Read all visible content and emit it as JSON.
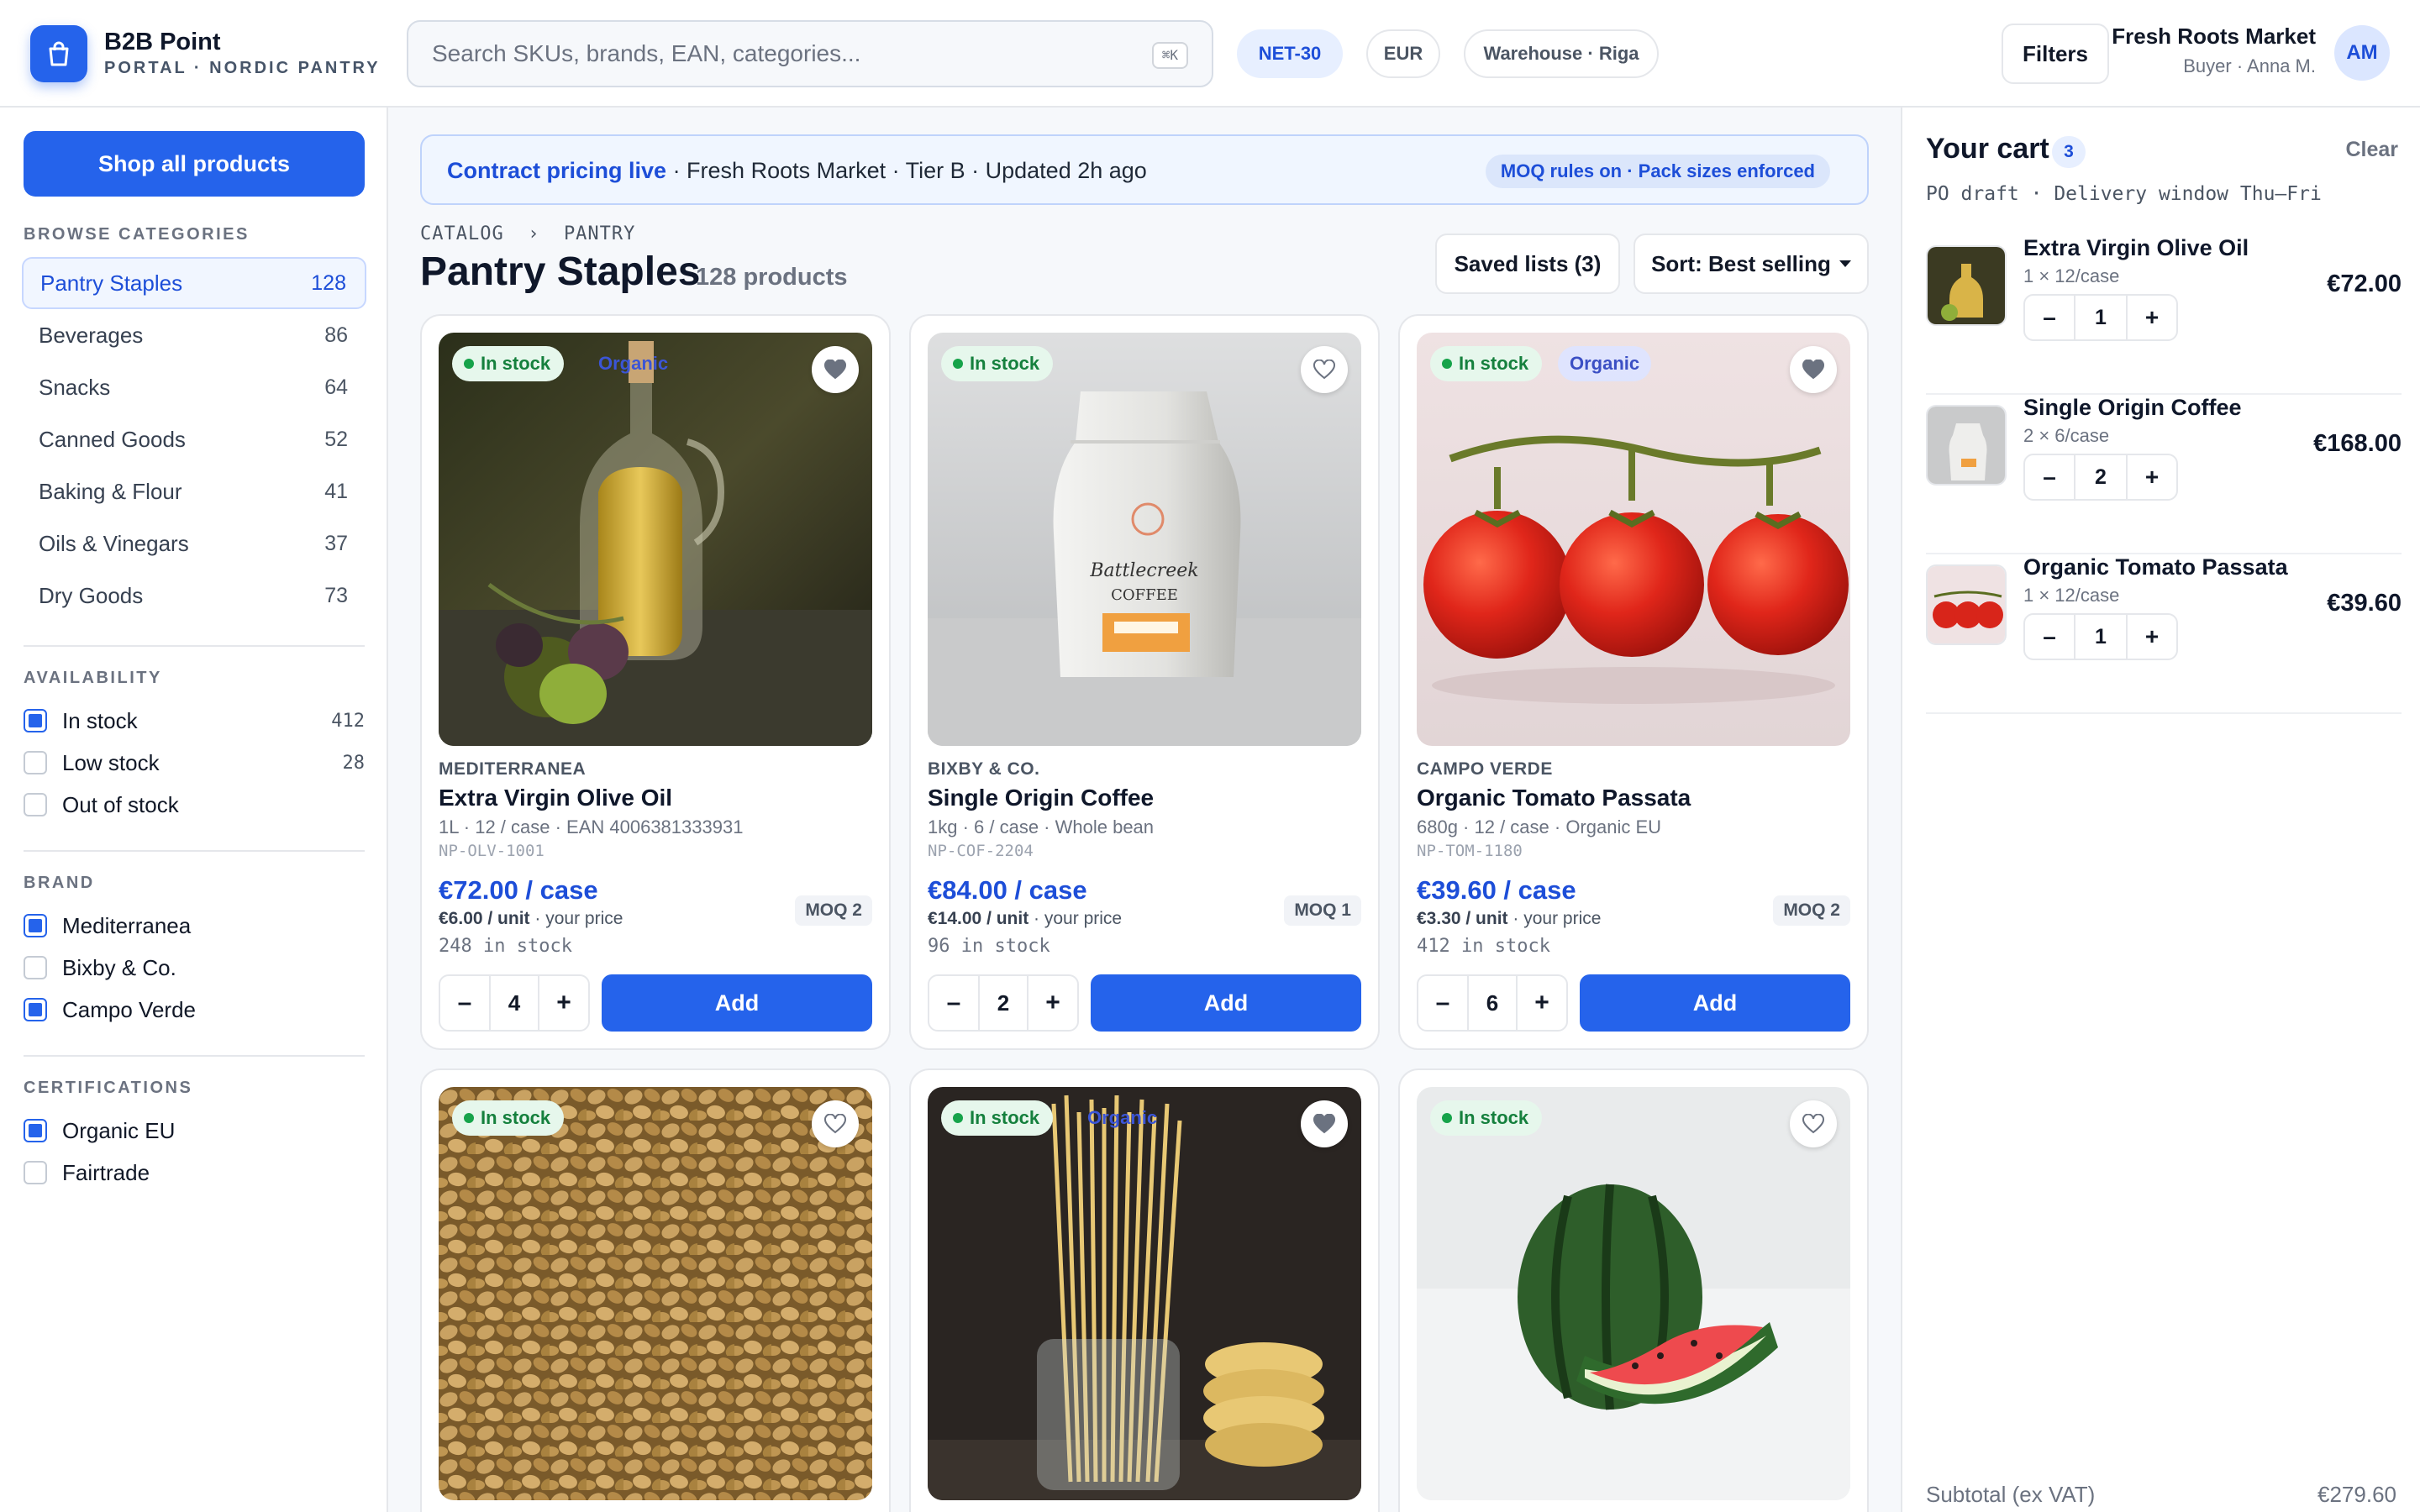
{
  "app": {
    "name": "B2B Point",
    "subtitle": "PORTAL · NORDIC PANTRY"
  },
  "search": {
    "placeholder": "Search SKUs, brands, EAN, categories...",
    "shortcut": "⌘K"
  },
  "pills": {
    "terms": "NET-30",
    "currency": "EUR",
    "warehouse": "Warehouse · Riga"
  },
  "header": {
    "filters_label": "Filters",
    "account_name": "Fresh Roots Market",
    "account_role": "Buyer · Anna M.",
    "avatar_initials": "AM"
  },
  "sidebar": {
    "shop_all_label": "Shop all products",
    "categories_title": "BROWSE CATEGORIES",
    "categories": [
      {
        "label": "Pantry Staples",
        "count": "128"
      },
      {
        "label": "Beverages",
        "count": "86"
      },
      {
        "label": "Snacks",
        "count": "64"
      },
      {
        "label": "Canned Goods",
        "count": "52"
      },
      {
        "label": "Baking & Flour",
        "count": "41"
      },
      {
        "label": "Oils & Vinegars",
        "count": "37"
      },
      {
        "label": "Dry Goods",
        "count": "73"
      }
    ],
    "availability_title": "AVAILABILITY",
    "availability": [
      {
        "label": "In stock",
        "count": "412",
        "checked": true
      },
      {
        "label": "Low stock",
        "count": "28",
        "checked": false
      },
      {
        "label": "Out of stock",
        "count": "",
        "checked": false
      }
    ],
    "brand_title": "BRAND",
    "brands": [
      {
        "label": "Mediterranea",
        "checked": true
      },
      {
        "label": "Bixby & Co.",
        "checked": false
      },
      {
        "label": "Campo Verde",
        "checked": true
      }
    ],
    "cert_title": "CERTIFICATIONS",
    "certs": [
      {
        "label": "Organic EU",
        "checked": true
      },
      {
        "label": "Fairtrade",
        "checked": false
      }
    ]
  },
  "banner": {
    "highlight": "Contract pricing live",
    "details": " · Fresh Roots Market · Tier B · Updated 2h ago",
    "rules": "MOQ rules on · Pack sizes enforced"
  },
  "main": {
    "breadcrumb": "CATALOG  ›  PANTRY",
    "title": "Pantry Staples",
    "count": "128 products",
    "saved_label": "Saved lists (3)",
    "sort_label": "Sort: Best selling"
  },
  "products": [
    {
      "stock_badge": "In stock",
      "organic_badge": "Organic",
      "brand": "MEDITERRANEA",
      "name": "Extra Virgin Olive Oil",
      "spec": "1L · 12 / case · EAN 4006381333931",
      "sku": "NP-OLV-1001",
      "price": "€72.00 / case",
      "unit_price": "€6.00 / unit",
      "unit_note": " · your price",
      "stock": "248 in stock",
      "moq": "MOQ 2",
      "qty": "4",
      "add_label": "Add"
    },
    {
      "stock_badge": "In stock",
      "organic_badge": "",
      "brand": "BIXBY & CO.",
      "name": "Single Origin Coffee",
      "spec": "1kg · 6 / case · Whole bean",
      "sku": "NP-COF-2204",
      "price": "€84.00 / case",
      "unit_price": "€14.00 / unit",
      "unit_note": " · your price",
      "stock": "96 in stock",
      "moq": "MOQ 1",
      "qty": "2",
      "add_label": "Add"
    },
    {
      "stock_badge": "In stock",
      "organic_badge": "Organic",
      "brand": "CAMPO VERDE",
      "name": "Organic Tomato Passata",
      "spec": "680g · 12 / case · Organic EU",
      "sku": "NP-TOM-1180",
      "price": "€39.60 / case",
      "unit_price": "€3.30 / unit",
      "unit_note": " · your price",
      "stock": "412 in stock",
      "moq": "MOQ 2",
      "qty": "6",
      "add_label": "Add"
    },
    {
      "stock_badge": "In stock",
      "organic_badge": ""
    },
    {
      "stock_badge": "In stock",
      "organic_badge": "Organic"
    },
    {
      "stock_badge": "In stock",
      "organic_badge": ""
    }
  ],
  "cart": {
    "title": "Your cart",
    "count": "3",
    "clear_label": "Clear",
    "subtitle": "PO draft · Delivery window Thu–Fri",
    "items": [
      {
        "name": "Extra Virgin Olive Oil",
        "pack": "1 × 12/case",
        "qty": "1",
        "price": "€72.00"
      },
      {
        "name": "Single Origin Coffee",
        "pack": "2 × 6/case",
        "qty": "2",
        "price": "€168.00"
      },
      {
        "name": "Organic Tomato Passata",
        "pack": "1 × 12/case",
        "qty": "1",
        "price": "€39.60"
      }
    ],
    "subtotal_label": "Subtotal (ex VAT)",
    "subtotal_value": "€279.60"
  },
  "colors": {
    "accent": "#2563eb",
    "accent_dark": "#1d4ed8",
    "success": "#16a34a"
  }
}
